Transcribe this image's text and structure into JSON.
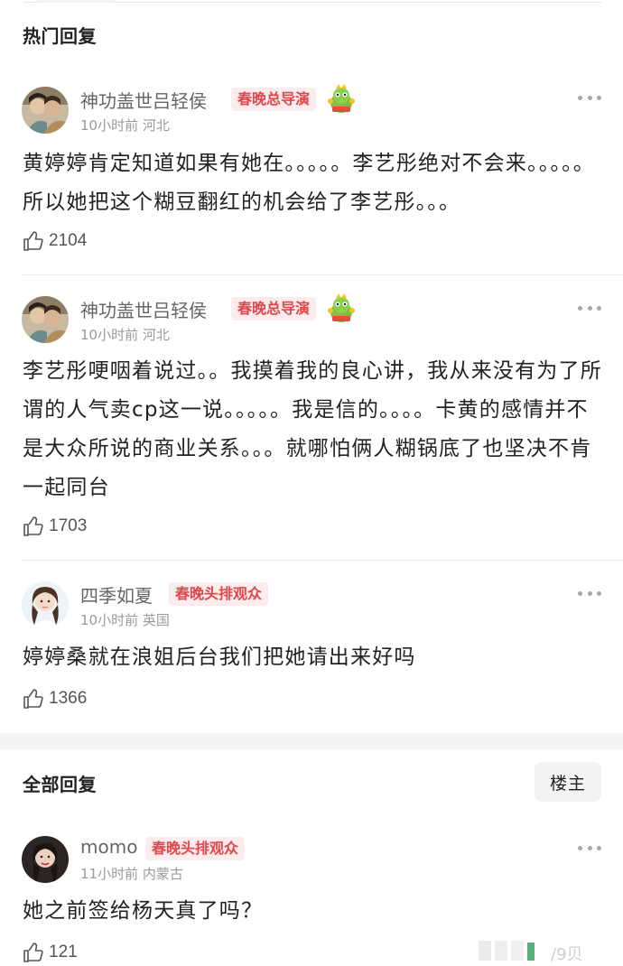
{
  "hot_section": {
    "title": "热门回复"
  },
  "all_section": {
    "title": "全部回复",
    "owner_button": "楼主"
  },
  "hot_replies": [
    {
      "username": "神功盖世吕轻侯",
      "badge": "春晚总导演",
      "time": "10小时前",
      "location": "河北",
      "text": "黄婷婷肯定知道如果有她在。。。。。李艺彤绝对不会来。。。。。所以她把这个糊豆翻红的机会给了李艺彤。。。",
      "likes": "2104"
    },
    {
      "username": "神功盖世吕轻侯",
      "badge": "春晚总导演",
      "time": "10小时前",
      "location": "河北",
      "text": "李艺彤哽咽着说过。。我摸着我的良心讲，我从来没有为了所谓的人气卖cp这一说。。。。。我是信的。。。。卡黄的感情并不是大众所说的商业关系。。。就哪怕俩人糊锅底了也坚决不肯一起同台",
      "likes": "1703"
    },
    {
      "username": "四季如夏",
      "badge": "春晚头排观众",
      "time": "10小时前",
      "location": "英国",
      "text": "婷婷桑就在浪姐后台我们把她请出来好吗",
      "likes": "1366"
    }
  ],
  "all_replies": [
    {
      "username": "momo",
      "badge": "春晚头排观众",
      "time": "11小时前",
      "location": "内蒙古",
      "text": "她之前签给杨天真了吗？",
      "likes": "121"
    }
  ],
  "watermark": {
    "text": "/9贝"
  },
  "colors": {
    "badge_bg": "#fdeced",
    "badge_text": "#e0464b",
    "meta": "#9a9a9a",
    "divider": "#ebebeb"
  },
  "icons": [
    "like-icon",
    "more-icon",
    "sticker-icon"
  ]
}
